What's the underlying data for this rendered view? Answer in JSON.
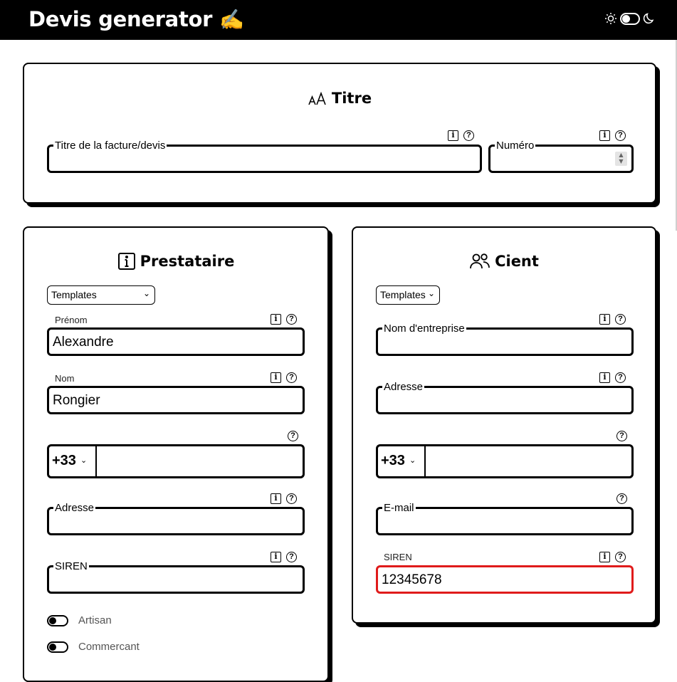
{
  "header": {
    "title": "Devis generator",
    "emoji": "✍️",
    "theme_toggle": {
      "left_icon": "sun-icon",
      "right_icon": "moon-icon"
    }
  },
  "titre_card": {
    "title": "Titre",
    "icon": "font-size-icon",
    "title_field": {
      "label": "Titre de la facture/devis",
      "value": ""
    },
    "number_field": {
      "label": "Numéro",
      "value": ""
    }
  },
  "prestataire": {
    "title": "Prestataire",
    "icon": "info-square-icon",
    "templates_label": "Templates",
    "prenom": {
      "label": "Prénom",
      "value": "Alexandre"
    },
    "nom": {
      "label": "Nom",
      "value": "Rongier"
    },
    "phone": {
      "code": "+33",
      "value": ""
    },
    "adresse": {
      "label": "Adresse",
      "value": ""
    },
    "siren": {
      "label": "SIREN",
      "value": ""
    },
    "switches": [
      {
        "label": "Artisan",
        "on": false
      },
      {
        "label": "Commercant",
        "on": false
      }
    ]
  },
  "client": {
    "title": "Cient",
    "icon": "users-icon",
    "templates_label": "Templates",
    "entreprise": {
      "label": "Nom d'entreprise",
      "value": ""
    },
    "adresse": {
      "label": "Adresse",
      "value": ""
    },
    "phone": {
      "code": "+33",
      "value": ""
    },
    "email": {
      "label": "E-mail",
      "value": ""
    },
    "siren": {
      "label": "SIREN",
      "value": "12345678",
      "error_color": "#e01b1b"
    }
  },
  "icon_glyphs": {
    "info": "i",
    "help": "?",
    "chevron": "⌄"
  }
}
